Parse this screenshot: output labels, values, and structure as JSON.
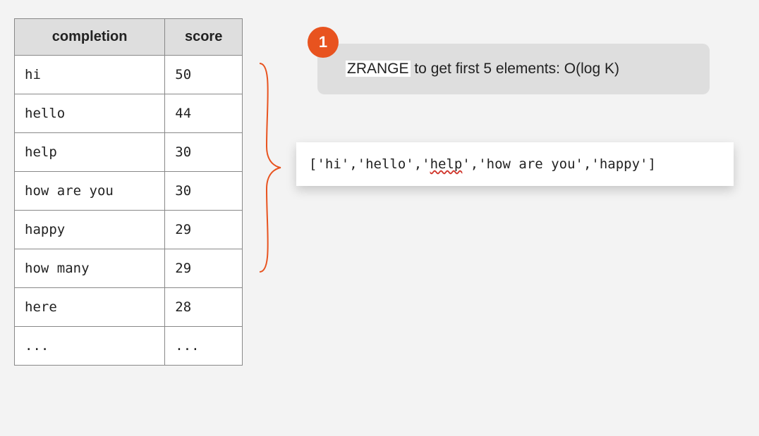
{
  "table": {
    "headers": {
      "completion": "completion",
      "score": "score"
    },
    "rows": [
      {
        "completion": "hi",
        "score": "50"
      },
      {
        "completion": "hello",
        "score": "44"
      },
      {
        "completion": "help",
        "score": "30"
      },
      {
        "completion": "how are you",
        "score": "30"
      },
      {
        "completion": "happy",
        "score": "29"
      },
      {
        "completion": "how many",
        "score": "29"
      },
      {
        "completion": "here",
        "score": "28"
      },
      {
        "completion": "...",
        "score": "..."
      }
    ]
  },
  "step": {
    "number": "1",
    "command": "ZRANGE",
    "text_rest": " to get first 5 elements: O(log K)"
  },
  "output": {
    "before": "['hi','hello','",
    "squiggle": "help",
    "after": "','how are you','happy']"
  }
}
